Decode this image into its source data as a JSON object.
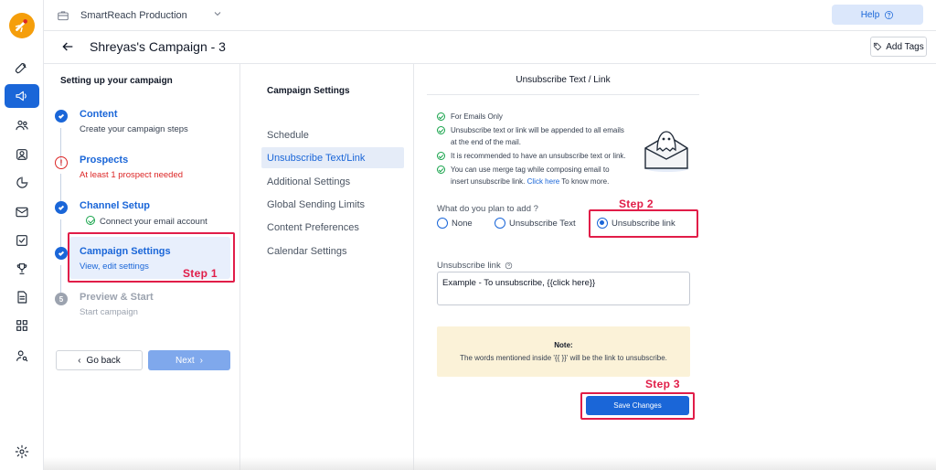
{
  "topbar": {
    "org_name": "SmartReach Production",
    "help_label": "Help"
  },
  "titlebar": {
    "title": "Shreyas's Campaign - 3",
    "add_tags_label": "Add Tags"
  },
  "steps_panel": {
    "heading": "Setting up your campaign",
    "steps": [
      {
        "title": "Content",
        "subtitle": "Create your campaign steps",
        "status": "done"
      },
      {
        "title": "Prospects",
        "subtitle": "At least 1 prospect needed",
        "status": "warning"
      },
      {
        "title": "Channel Setup",
        "subtitle": "Connect your email account",
        "status": "done"
      },
      {
        "title": "Campaign Settings",
        "subtitle": "View, edit settings",
        "status": "active"
      },
      {
        "title": "Preview & Start",
        "subtitle": "Start campaign",
        "status": "pending",
        "number": "5"
      }
    ],
    "go_back_label": "Go back",
    "next_label": "Next"
  },
  "settings_nav": {
    "heading": "Campaign Settings",
    "items": [
      {
        "label": "Schedule"
      },
      {
        "label": "Unsubscribe Text/Link"
      },
      {
        "label": "Additional Settings"
      },
      {
        "label": "Global Sending Limits"
      },
      {
        "label": "Content Preferences"
      },
      {
        "label": "Calendar Settings"
      }
    ],
    "active_index": 1
  },
  "main": {
    "title": "Unsubscribe Text / Link",
    "info": [
      "For Emails Only",
      "Unsubscribe text or link will be appended to all emails at the end of the mail.",
      "It is recommended to have an unsubscribe text or link.",
      "You can use merge tag while composing email to insert unsubscribe link."
    ],
    "info_link": "Click here",
    "info_link_suffix": "To know more.",
    "question": "What do you plan to add ?",
    "options": [
      {
        "label": "None",
        "selected": false
      },
      {
        "label": "Unsubscribe Text",
        "selected": false
      },
      {
        "label": "Unsubscribe link",
        "selected": true
      }
    ],
    "unsubscribe_link_label": "Unsubscribe link",
    "unsubscribe_link_value": "Example - To unsubscribe, {{click here}}",
    "note_title": "Note:",
    "note_text": "The words mentioned inside '{{ }}' will be the link to unsubscribe.",
    "save_label": "Save Changes"
  },
  "annotations": {
    "step1": "Step 1",
    "step2": "Step 2",
    "step3": "Step 3"
  },
  "colors": {
    "primary": "#1a66d8",
    "annotation": "#e11d48",
    "warning": "#dc2626",
    "success": "#16a34a",
    "note_bg": "#fbf2d8"
  }
}
